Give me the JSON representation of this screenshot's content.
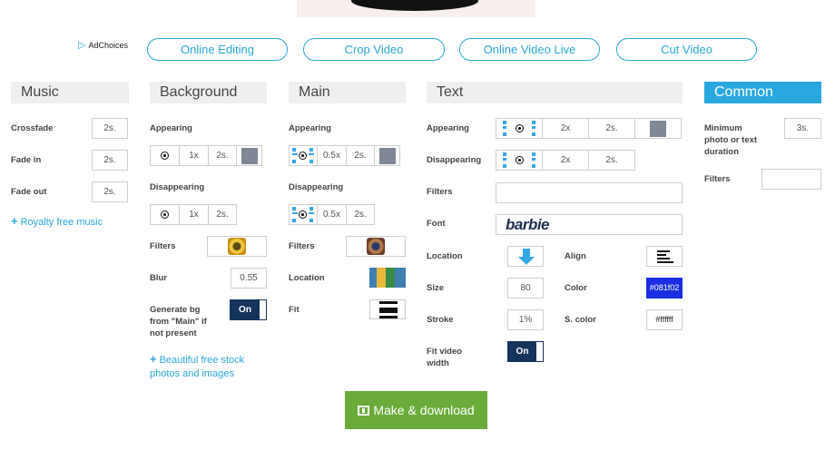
{
  "adchoices": "AdChoices",
  "nav_pills": [
    "Online Editing",
    "Crop Video",
    "Online Video Live",
    "Cut Video"
  ],
  "music": {
    "heading": "Music",
    "crossfade_label": "Crossfade",
    "crossfade_value": "2s.",
    "fadein_label": "Fade in",
    "fadein_value": "2s.",
    "fadeout_label": "Fade out",
    "fadeout_value": "2s.",
    "royalty_link": "Royalty free music"
  },
  "background": {
    "heading": "Background",
    "appearing_label": "Appearing",
    "appearing_speed": "1x",
    "appearing_time": "2s.",
    "disappearing_label": "Disappearing",
    "disappearing_speed": "1x",
    "disappearing_time": "2s.",
    "filters_label": "Filters",
    "blur_label": "Blur",
    "blur_value": "0.55",
    "generate_label_1": "Generate bg",
    "generate_label_2": "from \"Main\" if",
    "generate_label_3": "not present",
    "generate_toggle": "On",
    "stock_link_1": "Beautiful free stock",
    "stock_link_2": "photos and images"
  },
  "main": {
    "heading": "Main",
    "appearing_label": "Appearing",
    "appearing_speed": "0.5x",
    "appearing_time": "2s.",
    "disappearing_label": "Disappearing",
    "disappearing_speed": "0.5x",
    "disappearing_time": "2s.",
    "filters_label": "Filters",
    "location_label": "Location",
    "fit_label": "Fit"
  },
  "text": {
    "heading": "Text",
    "appearing_label": "Appearing",
    "appearing_speed": "2x",
    "appearing_time": "2s.",
    "disappearing_label": "Disappearing",
    "disappearing_speed": "2x",
    "disappearing_time": "2s.",
    "filters_label": "Filters",
    "font_label": "Font",
    "font_value": "barbie",
    "location_label": "Location",
    "align_label": "Align",
    "size_label": "Size",
    "size_value": "80",
    "color_label": "Color",
    "color_value": "#081f02",
    "stroke_label": "Stroke",
    "stroke_value": "1%",
    "scolor_label": "S. color",
    "scolor_value": "#ffffff",
    "fit_label_1": "Fit video",
    "fit_label_2": "width",
    "fit_toggle": "On"
  },
  "common": {
    "heading": "Common",
    "min_label_1": "Minimum",
    "min_label_2": "photo or text",
    "min_label_3": "duration",
    "min_value": "3s.",
    "filters_label": "Filters"
  },
  "make_button": "Make & download",
  "colors": {
    "accent": "#29a8e0",
    "make_button": "#6aab3a",
    "toggle": "#15345b",
    "text_color_box": "#1b2ee3"
  }
}
